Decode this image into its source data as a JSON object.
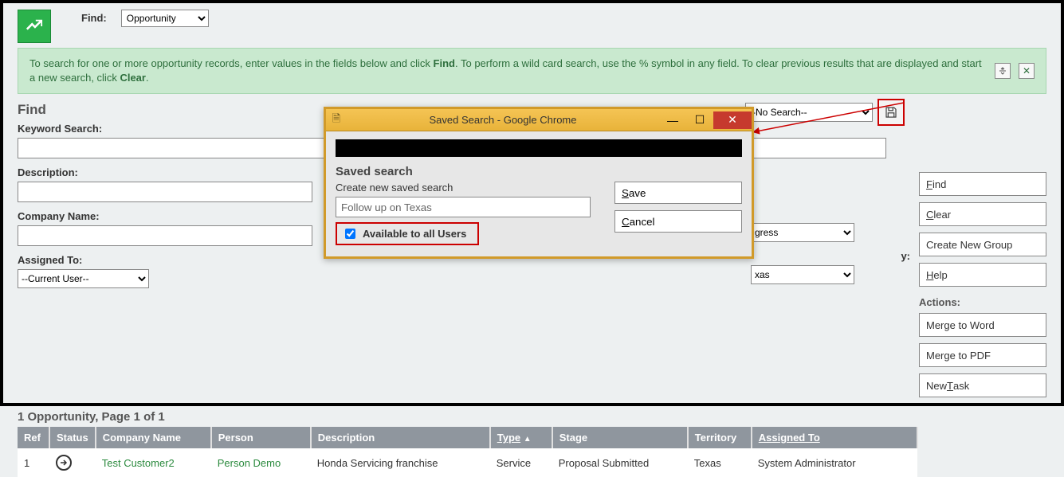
{
  "top": {
    "find_label": "Find:",
    "find_select_value": "Opportunity"
  },
  "banner": {
    "text_pre": "To search for one or more opportunity records, enter values in the fields below and click ",
    "bold1": "Find",
    "text_mid": ". To perform a wild card search, use the % symbol in any field. To clear previous results that are displayed and start a new search, click ",
    "bold2": "Clear",
    "text_post": "."
  },
  "find_panel": {
    "title": "Find",
    "keyword_label": "Keyword Search:",
    "description_label": "Description:",
    "company_label": "Company Name:",
    "assigned_label": "Assigned To:",
    "assigned_value": "--Current User--",
    "nosearch_value": "--No Search--",
    "stage_suffix": "gress",
    "territory_label_suffix": "y:",
    "territory_value_suffix": "xas"
  },
  "side": {
    "find": "ind",
    "find_u": "F",
    "clear": "lear",
    "clear_u": "C",
    "create_group": "Create New Group",
    "help": "elp",
    "help_u": "H",
    "actions_label": "Actions:",
    "merge_word": "Merge to Word",
    "merge_pdf": "Merge to PDF",
    "new_task_u": "T",
    "new_task_pre": "New ",
    "new_task_post": "ask"
  },
  "results": {
    "title": "1 Opportunity, Page 1 of 1",
    "cols": {
      "ref": "Ref",
      "status": "Status",
      "company": "Company Name",
      "person": "Person",
      "desc": "Description",
      "type": "Type",
      "stage": "Stage",
      "territory": "Territory",
      "assigned": "Assigned To"
    },
    "row": {
      "ref": "1",
      "company": "Test Customer2",
      "person": "Person Demo",
      "desc": "Honda Servicing franchise",
      "type": "Service",
      "stage": "Proposal Submitted",
      "territory": "Texas",
      "assigned": "System Administrator"
    }
  },
  "popup": {
    "window_title": "Saved Search - Google Chrome",
    "heading": "Saved search",
    "sub": "Create new saved search",
    "input_value": "Follow up on Texas",
    "chk_label": "Available to all Users",
    "save_u": "S",
    "save_rest": "ave",
    "cancel_u": "C",
    "cancel_rest": "ancel"
  }
}
